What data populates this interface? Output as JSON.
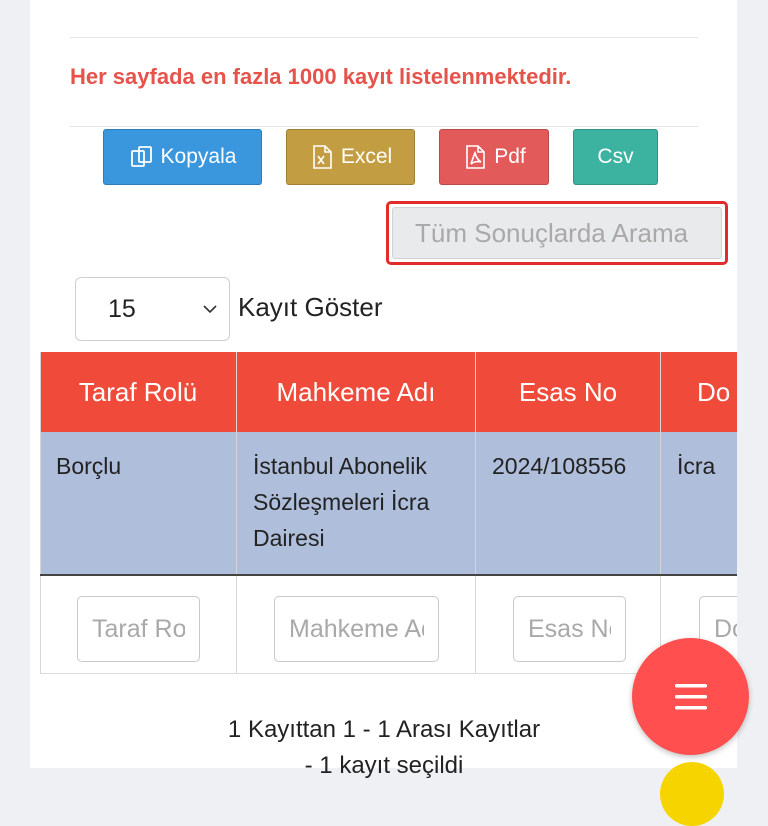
{
  "notice": "Her sayfada en fazla 1000 kayıt listelenmektedir.",
  "toolbar": {
    "copy": "Kopyala",
    "excel": "Excel",
    "pdf": "Pdf",
    "csv": "Csv"
  },
  "search": {
    "placeholder": "Tüm Sonuçlarda Arama"
  },
  "page_size": {
    "value": "15",
    "label": "Kayıt Göster"
  },
  "table": {
    "headers": [
      "Taraf Rolü",
      "Mahkeme Adı",
      "Esas No",
      "Do"
    ],
    "rows": [
      [
        "Borçlu",
        "İstanbul Abonelik\nSözleşmeleri İcra\nDairesi",
        "2024/108556",
        "İcra"
      ]
    ],
    "filters": [
      "Taraf Rolü",
      "Mahkeme Adı",
      "Esas No",
      "Dosya"
    ]
  },
  "footer": {
    "summary": "1 Kayıttan 1 - 1 Arası Kayıtlar",
    "selected": "- 1 kayıt seçildi"
  },
  "colors": {
    "header": "#f04a3a",
    "row": "#afbedb",
    "notice": "#e5534b",
    "fab": "#ff4f4f"
  },
  "icons": {
    "copy": "copy-icon",
    "excel": "excel-icon",
    "pdf": "pdf-icon",
    "menu": "menu-icon"
  }
}
